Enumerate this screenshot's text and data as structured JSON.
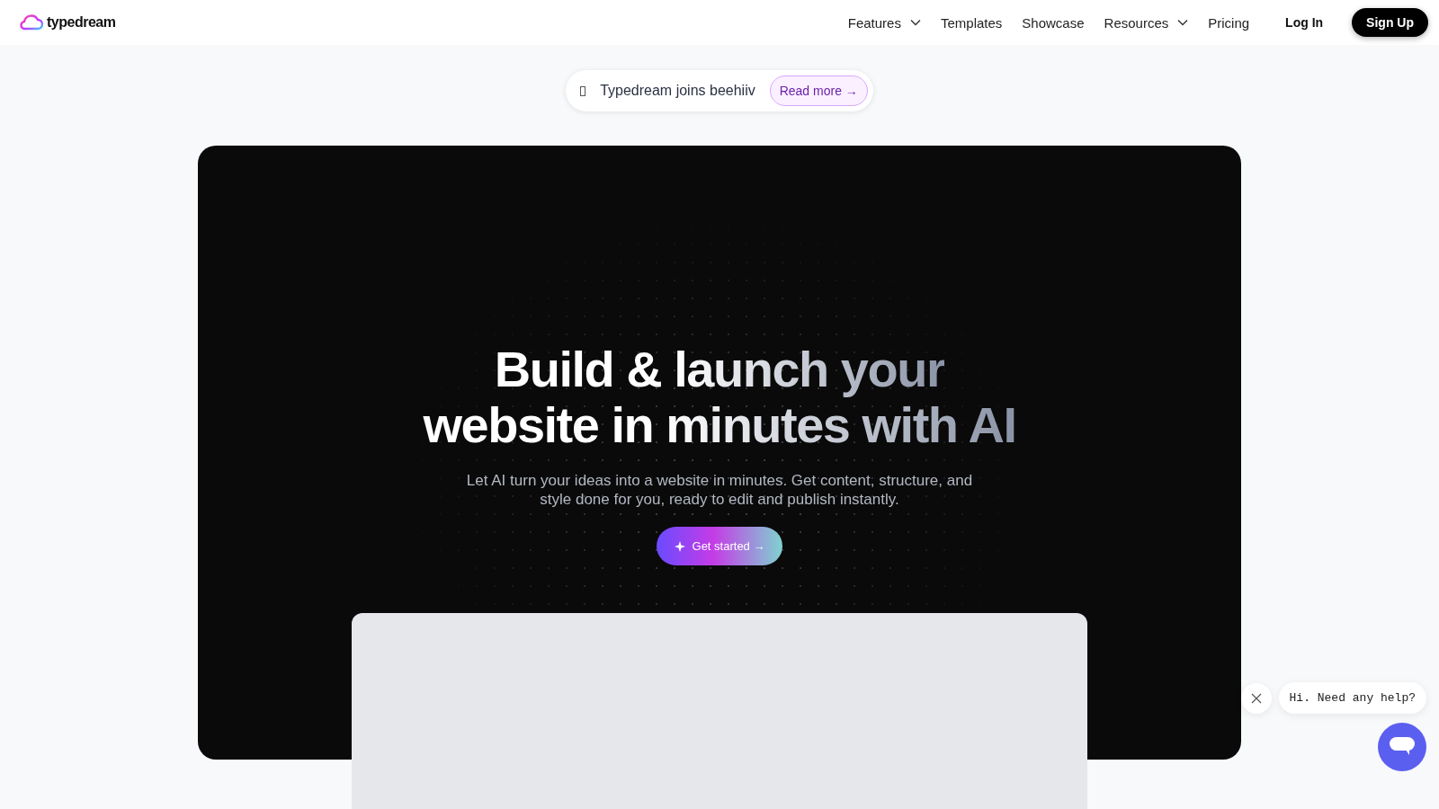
{
  "header": {
    "logo": "typedream",
    "nav": [
      {
        "label": "Features",
        "has_menu": true
      },
      {
        "label": "Templates",
        "has_menu": false
      },
      {
        "label": "Showcase",
        "has_menu": false
      },
      {
        "label": "Resources",
        "has_menu": true
      },
      {
        "label": "Pricing",
        "has_menu": false
      }
    ],
    "login": "Log In",
    "signup": "Sign Up"
  },
  "announcement": {
    "text": "Typedream joins beehiiv",
    "link": "Read more →"
  },
  "hero": {
    "title_lines": [
      "Build & launch your",
      "website in minutes with AI"
    ],
    "subtitle": "Let AI turn your ideas into a website in minutes. Get content, structure, and style done for you, ready to edit and publish instantly.",
    "cta": "Get started →"
  },
  "chat": {
    "message": "Hi. Need any help?"
  }
}
